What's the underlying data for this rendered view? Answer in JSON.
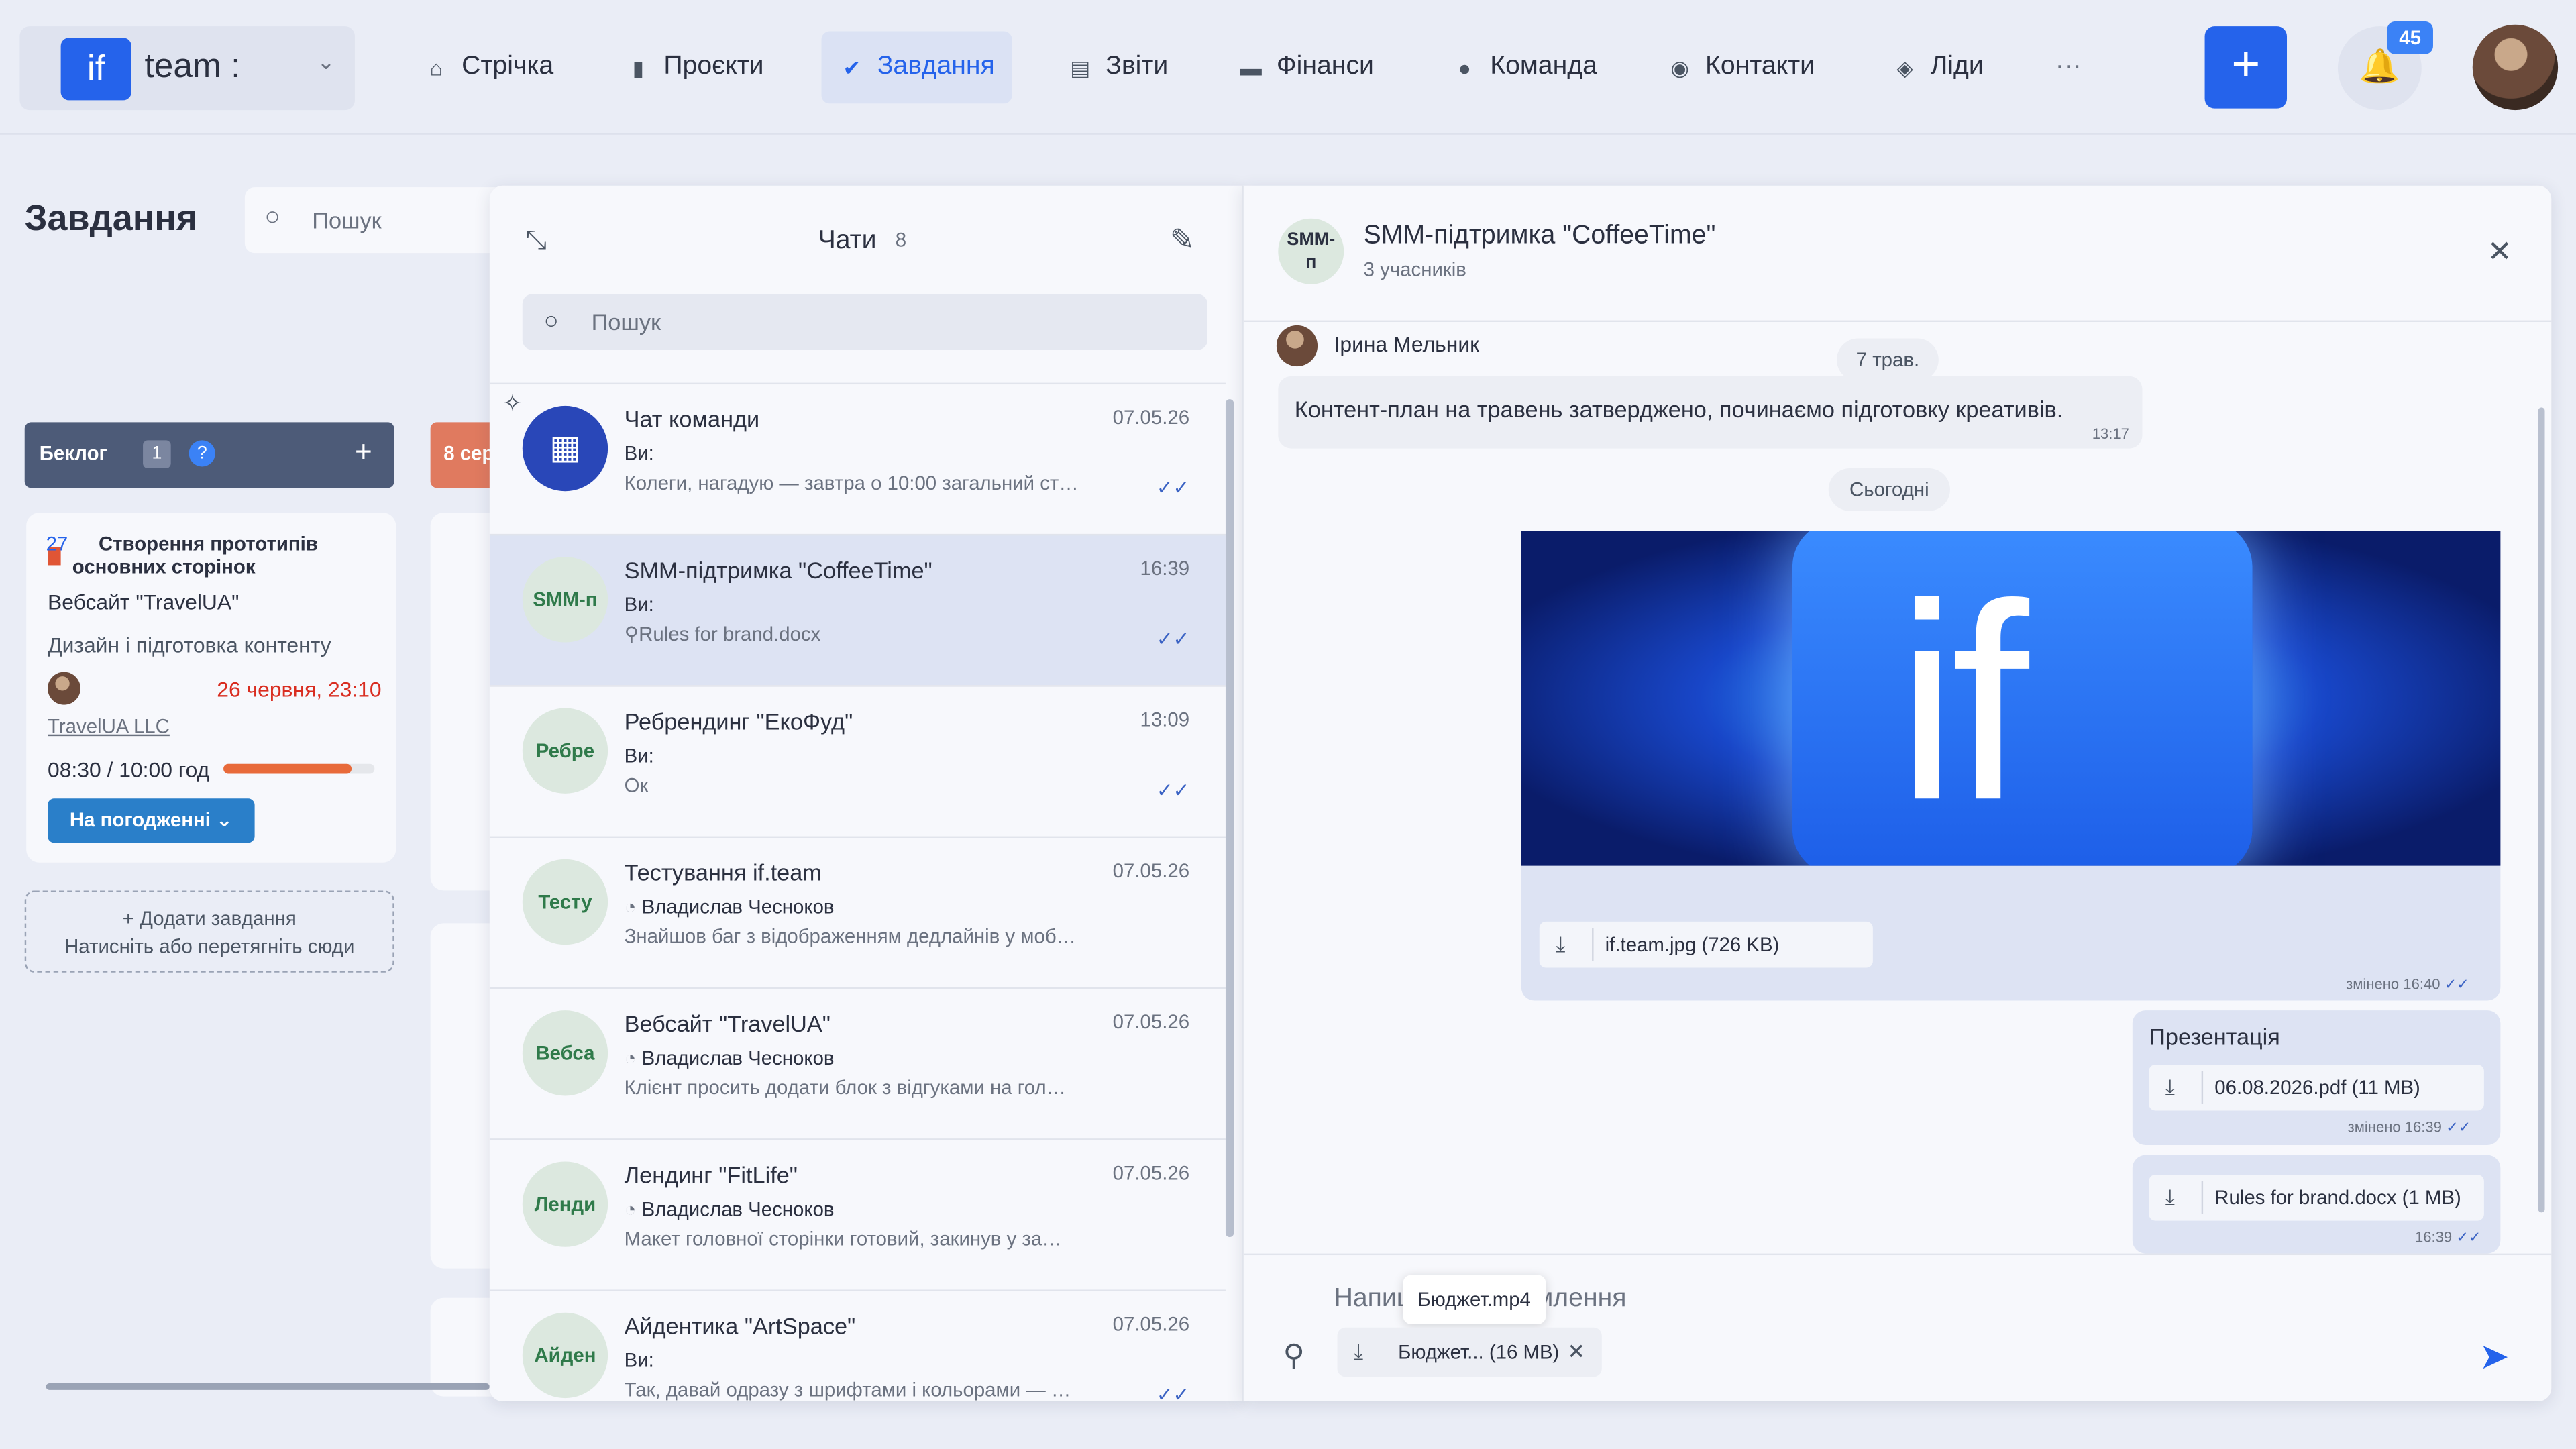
{
  "brand": {
    "logo": "if",
    "name": "team :"
  },
  "nav": [
    {
      "label": "Стрічка",
      "icon": "home-icon"
    },
    {
      "label": "Проєкти",
      "icon": "document-icon"
    },
    {
      "label": "Завдання",
      "icon": "check-circle-icon",
      "active": true
    },
    {
      "label": "Звіти",
      "icon": "report-icon"
    },
    {
      "label": "Фінанси",
      "icon": "wallet-icon"
    },
    {
      "label": "Команда",
      "icon": "person-icon"
    },
    {
      "label": "Контакти",
      "icon": "contacts-icon"
    },
    {
      "label": "Ліди",
      "icon": "leads-icon"
    }
  ],
  "notifications": {
    "count": "45"
  },
  "page": {
    "title": "Завдання",
    "search_placeholder": "Пошук"
  },
  "board": {
    "column1": {
      "title": "Беклог",
      "count": "1",
      "help": "?"
    },
    "column2": {
      "title": "8 сер"
    },
    "card": {
      "number": "27",
      "title": "Створення прототипів основних сторінок",
      "project": "Вебсайт \"TravelUA\"",
      "stage": "Дизайн і підготовка контенту",
      "due": "26 червня, 23:10",
      "client": "TravelUA LLC",
      "hours": "08:30 / 10:00 год",
      "progress": 0.85,
      "status": "На погодженні ⌄"
    },
    "add_task": {
      "line1": "+ Додати завдання",
      "line2": "Натисніть або перетягніть сюди"
    }
  },
  "chats": {
    "title": "Чати",
    "count": "8",
    "search_placeholder": "Пошук",
    "items": [
      {
        "avatar": "▦",
        "name": "Чат команди",
        "time": "07.05.26",
        "who": "Ви:",
        "message": "Колеги, нагадую — завтра о 10:00 загальний ст…",
        "ticks": true
      },
      {
        "avatar": "SMM-п",
        "name": "SMM-підтримка \"CoffeeTime\"",
        "time": "16:39",
        "who": "Ви:",
        "message": "Rules for brand.docx",
        "ticks": true,
        "selected": true
      },
      {
        "avatar": "Ребре",
        "name": "Ребрендинг \"ЕкоФуд\"",
        "time": "13:09",
        "who": "Ви:",
        "message": "Ок",
        "ticks": true
      },
      {
        "avatar": "Тесту",
        "name": "Тестування if.team",
        "time": "07.05.26",
        "who": "Владислав Чесноков",
        "message": "Знайшов баг з відображенням дедлайнів у моб…"
      },
      {
        "avatar": "Вебса",
        "name": "Вебсайт \"TravelUA\"",
        "time": "07.05.26",
        "who": "Владислав Чесноков",
        "message": "Клієнт просить додати блок з відгуками на гол…"
      },
      {
        "avatar": "Ленди",
        "name": "Лендинг \"FitLife\"",
        "time": "07.05.26",
        "who": "Владислав Чесноков",
        "message": "Макет головної сторінки готовий, закинув у за…"
      },
      {
        "avatar": "Айден",
        "name": "Айдентика \"ArtSpace\"",
        "time": "07.05.26",
        "who": "Ви:",
        "message": "Так, давай одразу з шрифтами і кольорами — …",
        "ticks": true
      }
    ]
  },
  "conversation": {
    "avatar_line1": "SMM-",
    "avatar_line2": "п",
    "title": "SMM-підтримка \"CoffeeTime\"",
    "subtitle": "3 учасників",
    "sender": "Ірина Мельник",
    "date1": "7 трав.",
    "message1": {
      "text": "Контент-план на травень затверджено, починаємо підготовку креативів.",
      "time": "13:17"
    },
    "date2": "Сьогодні",
    "image": {
      "letters": "if",
      "file": "if.team.jpg (726 KB)",
      "meta": "змінено 16:40"
    },
    "presentation": {
      "title": "Презентація",
      "file": "06.08.2026.pdf (11 MB)",
      "meta": "змінено 16:39"
    },
    "doc": {
      "file": "Rules for brand.docx (1 MB)",
      "meta": "16:39"
    },
    "input_placeholder": "Напишіть повідомлення",
    "tooltip": "Бюджет.mp4",
    "attachment": "Бюджет... (16 MB)"
  }
}
